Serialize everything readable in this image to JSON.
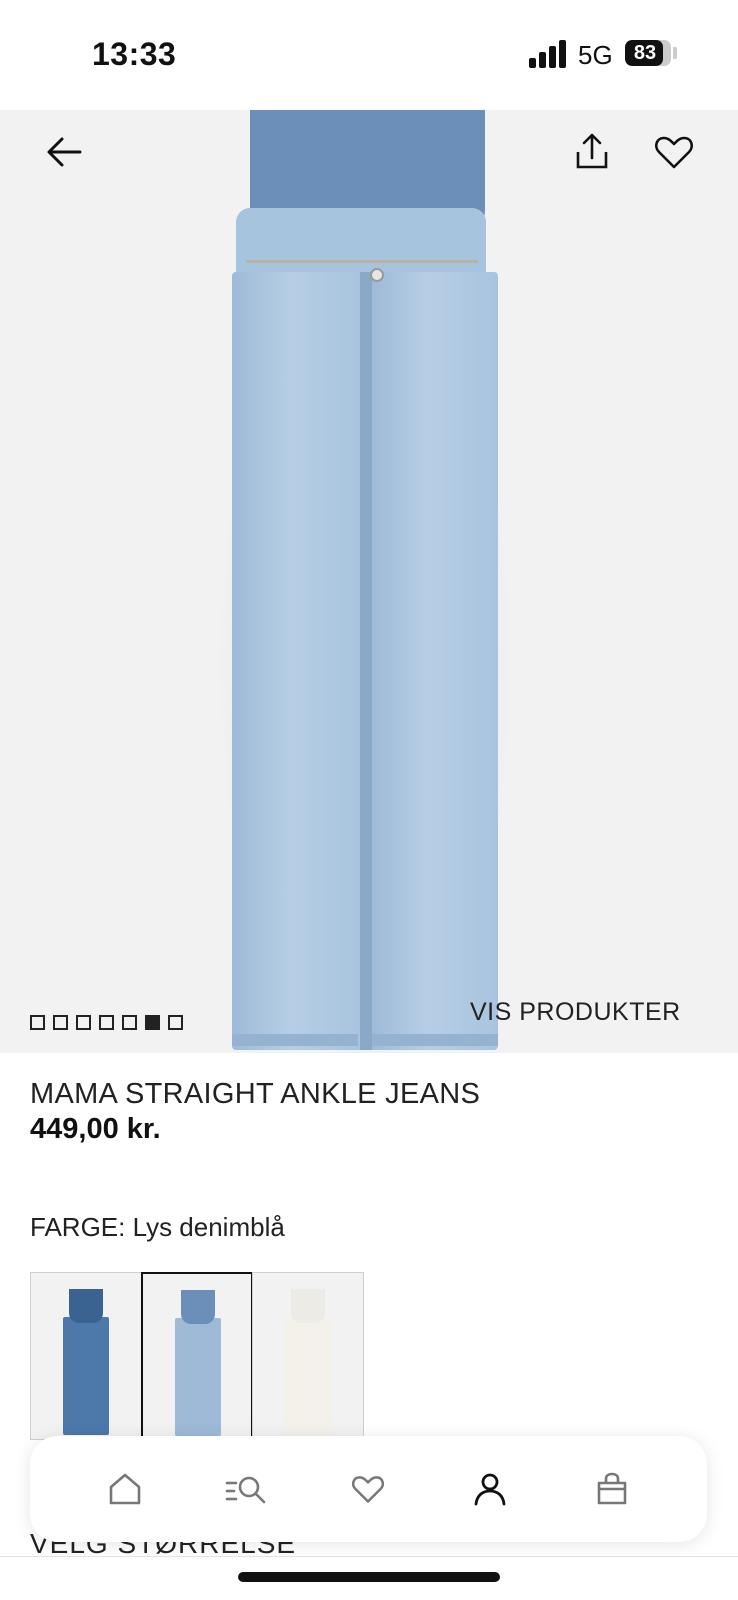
{
  "status_bar": {
    "time": "13:33",
    "network": "5G",
    "battery": "83",
    "battery_level": 0.83
  },
  "header": {
    "back_icon": "arrow-left-icon",
    "share_icon": "share-icon",
    "favorite_icon": "heart-icon"
  },
  "gallery": {
    "dot_count": 7,
    "active_dot": 6,
    "show_products_label": "VIS PRODUKTER"
  },
  "product": {
    "title": "MAMA STRAIGHT ANKLE JEANS",
    "price": "449,00 kr.",
    "color_label": "FARGE: Lys denimblå"
  },
  "swatches": [
    {
      "name": "mid-denim",
      "band_color": "#3b6391",
      "leg_color": "#4c78aa",
      "selected": false
    },
    {
      "name": "light-denim",
      "band_color": "#6b8fb8",
      "leg_color": "#9ebad7",
      "selected": true
    },
    {
      "name": "cream",
      "band_color": "#ecebe6",
      "leg_color": "#f3f1ea",
      "selected": false
    }
  ],
  "size_section": {
    "label": "VELG STØRRELSE"
  },
  "tabbar": {
    "items": [
      "home-icon",
      "search-menu-icon",
      "heart-icon",
      "account-icon",
      "bag-icon"
    ],
    "active": "account-icon"
  },
  "colors": {
    "text": "#222222",
    "hero_background": "#f2f2f2",
    "denim_light": "#9ebad7",
    "maternity_band": "#6b8fb8"
  }
}
